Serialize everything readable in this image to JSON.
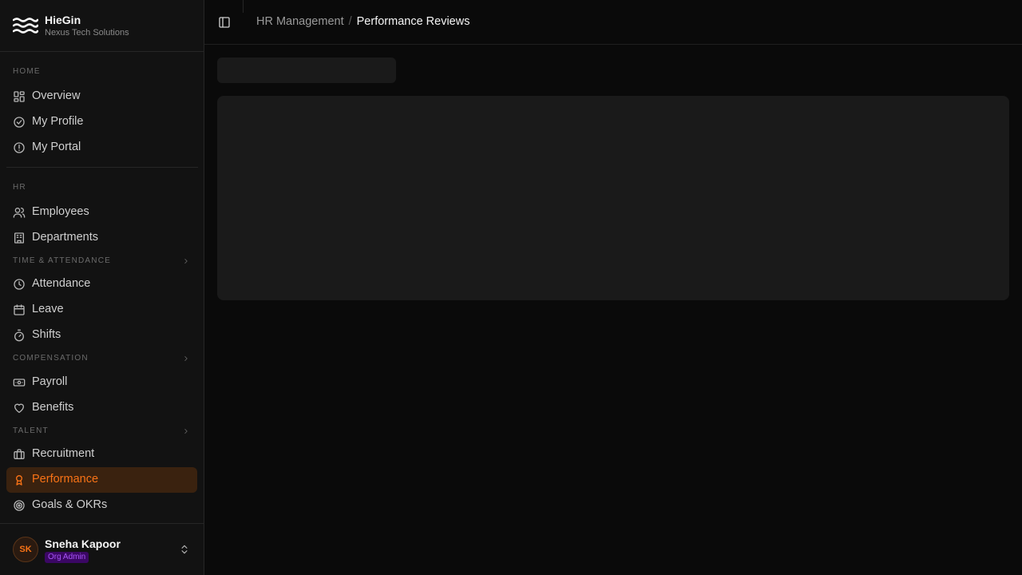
{
  "brand": {
    "name": "HieGin",
    "org": "Nexus Tech Solutions",
    "logo_icon": "waves-logo-icon"
  },
  "breadcrumb": {
    "parent": "HR Management",
    "separator": "/",
    "current": "Performance Reviews"
  },
  "sections": {
    "home": "HOME",
    "hr": "HR",
    "time": "TIME & ATTENDANCE",
    "compensation": "COMPENSATION",
    "talent": "TALENT"
  },
  "nav": {
    "overview": {
      "label": "Overview",
      "icon": "grid-icon"
    },
    "my_profile": {
      "label": "My Profile",
      "icon": "check-circle-icon"
    },
    "my_portal": {
      "label": "My Portal",
      "icon": "alert-circle-icon"
    },
    "employees": {
      "label": "Employees",
      "icon": "users-icon"
    },
    "departments": {
      "label": "Departments",
      "icon": "building-icon"
    },
    "attendance": {
      "label": "Attendance",
      "icon": "clock-icon"
    },
    "leave": {
      "label": "Leave",
      "icon": "calendar-icon"
    },
    "shifts": {
      "label": "Shifts",
      "icon": "timer-icon"
    },
    "payroll": {
      "label": "Payroll",
      "icon": "banknote-icon"
    },
    "benefits": {
      "label": "Benefits",
      "icon": "heart-icon"
    },
    "recruitment": {
      "label": "Recruitment",
      "icon": "briefcase-icon"
    },
    "performance": {
      "label": "Performance",
      "icon": "award-icon",
      "active": true
    },
    "goals": {
      "label": "Goals & OKRs",
      "icon": "target-icon"
    }
  },
  "user": {
    "initials": "SK",
    "name": "Sneha Kapoor",
    "role": "Org Admin"
  },
  "colors": {
    "accent": "#f97316",
    "active_bg": "#3a220f",
    "badge_bg": "#3b0764",
    "badge_text": "#a855f7",
    "bg": "#0a0a0a",
    "sidebar_bg": "#121212"
  }
}
